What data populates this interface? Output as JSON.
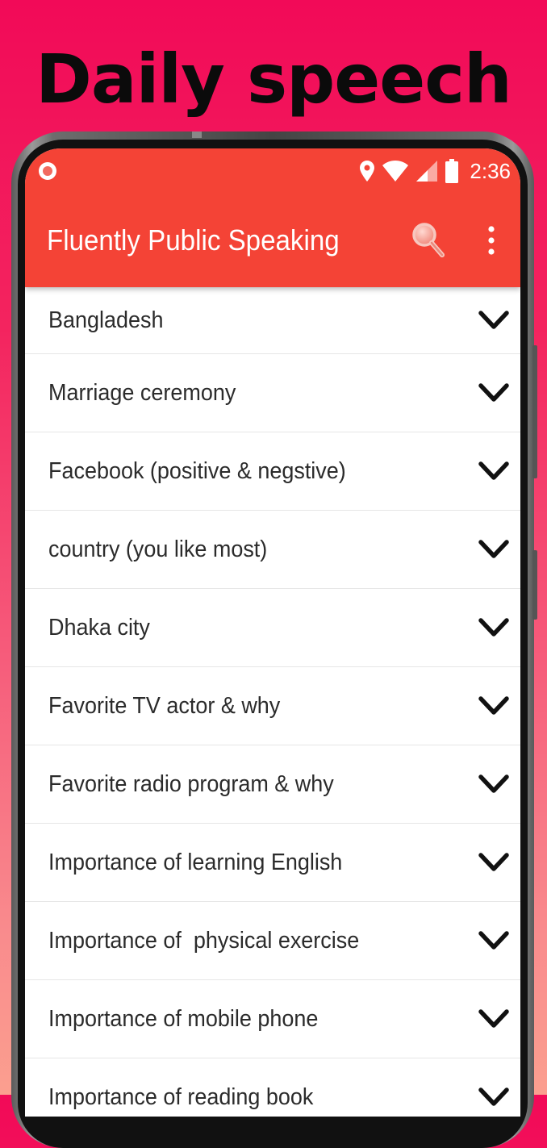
{
  "headline": "Daily speech",
  "status_bar": {
    "time": "2:36",
    "icons": [
      "record-indicator-icon",
      "location-icon",
      "wifi-icon",
      "signal-icon",
      "battery-icon"
    ]
  },
  "app_bar": {
    "title": "Fluently Public Speaking",
    "background_color": "#f44336",
    "actions": [
      "search-icon",
      "more-vert-icon"
    ]
  },
  "topics": [
    {
      "label": "Bangladesh"
    },
    {
      "label": "Marriage ceremony"
    },
    {
      "label": "Facebook (positive & negstive)"
    },
    {
      "label": "country (you like most)"
    },
    {
      "label": "Dhaka city"
    },
    {
      "label": "Favorite TV actor & why"
    },
    {
      "label": "Favorite radio program & why"
    },
    {
      "label": "Importance of learning English"
    },
    {
      "label": "Importance of  physical exercise"
    },
    {
      "label": "Importance of mobile phone"
    },
    {
      "label": "Importance of reading book"
    }
  ],
  "colors": {
    "accent": "#f44336",
    "background_top": "#f20a58",
    "background_bottom": "#fb9f8f"
  }
}
